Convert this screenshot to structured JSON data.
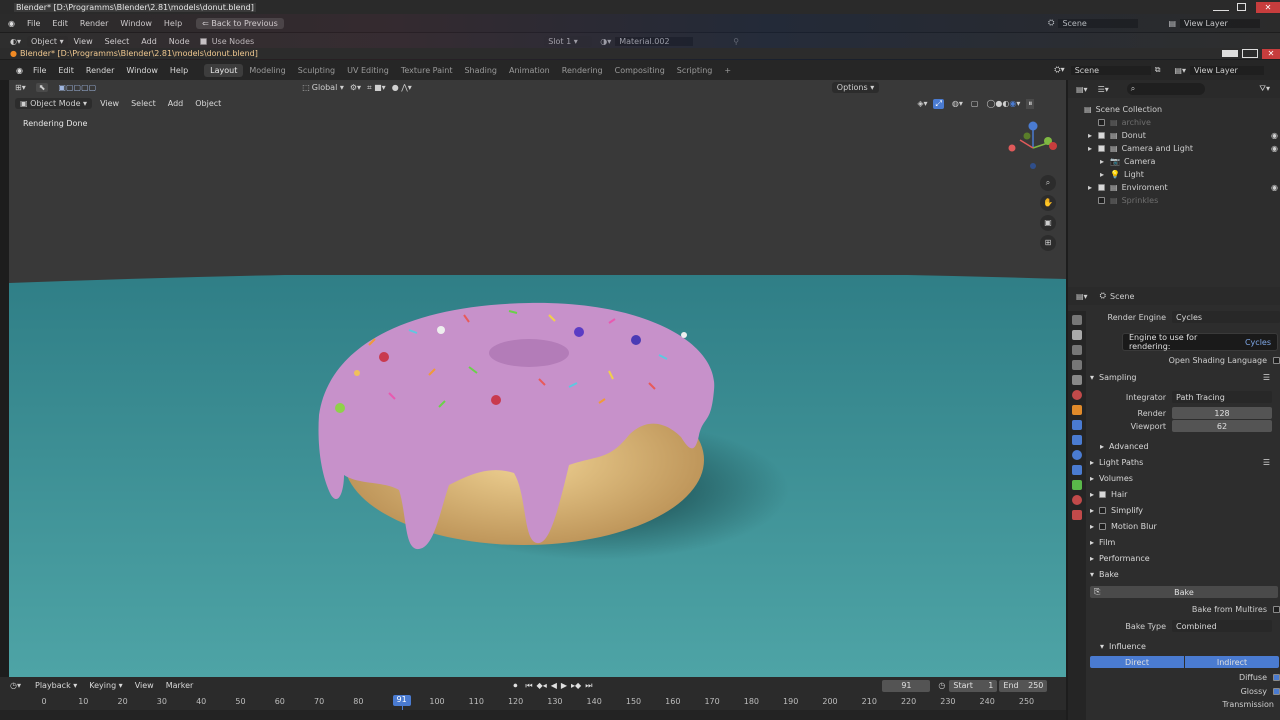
{
  "bg_window": {
    "title": "Blender* [D:\\Programms\\Blender\\2.81\\models\\donut.blend]",
    "menu": [
      "File",
      "Edit",
      "Render",
      "Window",
      "Help"
    ],
    "back_button": "Back to Previous",
    "scene": "Scene",
    "view_layer": "View Layer",
    "node_bar": {
      "mode": "Object",
      "items": [
        "View",
        "Select",
        "Add",
        "Node"
      ],
      "use_nodes": "Use Nodes",
      "slot": "Slot 1",
      "material": "Material.002"
    }
  },
  "window": {
    "title": "Blender* [D:\\Programms\\Blender\\2.81\\models\\donut.blend]",
    "menu": [
      "File",
      "Edit",
      "Render",
      "Window",
      "Help"
    ],
    "workspaces": [
      "Layout",
      "Modeling",
      "Sculpting",
      "UV Editing",
      "Texture Paint",
      "Shading",
      "Animation",
      "Rendering",
      "Compositing",
      "Scripting"
    ],
    "active_workspace": "Layout",
    "scene": "Scene",
    "view_layer": "View Layer"
  },
  "viewport": {
    "mode": "Object Mode",
    "menu": [
      "View",
      "Select",
      "Add",
      "Object"
    ],
    "transform_orientation": "Global",
    "options": "Options",
    "status": "Rendering Done",
    "axes": {
      "x": "X",
      "y": "Y",
      "z": "Z"
    }
  },
  "outliner": {
    "root": "Scene Collection",
    "items": [
      {
        "label": "archive",
        "checked": false,
        "dim": true,
        "indent": 0
      },
      {
        "label": "Donut",
        "checked": true,
        "dim": false,
        "indent": 0
      },
      {
        "label": "Camera and Light",
        "checked": true,
        "dim": false,
        "indent": 0
      },
      {
        "label": "Camera",
        "checked": false,
        "dim": false,
        "indent": 1
      },
      {
        "label": "Light",
        "checked": false,
        "dim": false,
        "indent": 1
      },
      {
        "label": "Enviroment",
        "checked": true,
        "dim": false,
        "indent": 0
      },
      {
        "label": "Sprinkles",
        "checked": false,
        "dim": true,
        "indent": 0
      }
    ]
  },
  "properties": {
    "context": "Scene",
    "render_engine_label": "Render Engine",
    "render_engine": "Cycles",
    "tooltip_text": "Engine to use for rendering:",
    "tooltip_value": "Cycles",
    "osl": "Open Shading Language",
    "sampling": "Sampling",
    "integrator_label": "Integrator",
    "integrator": "Path Tracing",
    "render_label": "Render",
    "render_samples": "128",
    "viewport_label": "Viewport",
    "viewport_samples": "62",
    "advanced": "Advanced",
    "light_paths": "Light Paths",
    "volumes": "Volumes",
    "hair": "Hair",
    "simplify": "Simplify",
    "motion_blur": "Motion Blur",
    "film": "Film",
    "performance": "Performance",
    "bake": "Bake",
    "bake_button": "Bake",
    "bake_from_multires": "Bake from Multires",
    "bake_type_label": "Bake Type",
    "bake_type": "Combined",
    "influence": "Influence",
    "direct": "Direct",
    "indirect": "Indirect",
    "diffuse": "Diffuse",
    "glossy": "Glossy",
    "transmission": "Transmission"
  },
  "timeline": {
    "menu": [
      "Playback",
      "Keying",
      "View",
      "Marker"
    ],
    "current_frame": "91",
    "start_label": "Start",
    "start": "1",
    "end_label": "End",
    "end": "250",
    "ticks": [
      "0",
      "10",
      "20",
      "30",
      "40",
      "50",
      "60",
      "70",
      "80",
      "90",
      "100",
      "110",
      "120",
      "130",
      "140",
      "150",
      "160",
      "170",
      "180",
      "190",
      "200",
      "210",
      "220",
      "230",
      "240",
      "250"
    ]
  },
  "colors": {
    "accent": "#4a7bd1",
    "floor": "#3f9a9e",
    "icing": "#c58fc8",
    "dough": "#d9b27a"
  }
}
